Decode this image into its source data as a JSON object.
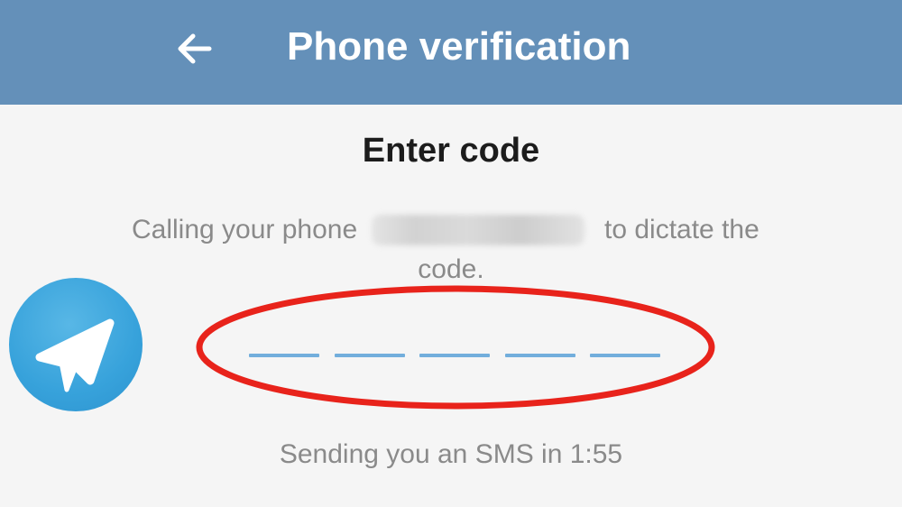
{
  "app_bar": {
    "title": "Phone verification",
    "background_color": "#6490b9",
    "back_icon": "arrow-left-icon"
  },
  "main": {
    "heading": "Enter code",
    "description_prefix": "Calling your phone",
    "description_suffix": "to dictate the",
    "description_line2": "code.",
    "phone_number_redacted": true,
    "code_length": 5,
    "code_slot_color": "#72aedc",
    "sms_timer_text": "Sending you an SMS in 1:55"
  },
  "overlay": {
    "logo": "telegram-logo-icon",
    "logo_color": "#37a2db",
    "highlight": "red-ellipse",
    "highlight_color": "#e8231b"
  }
}
